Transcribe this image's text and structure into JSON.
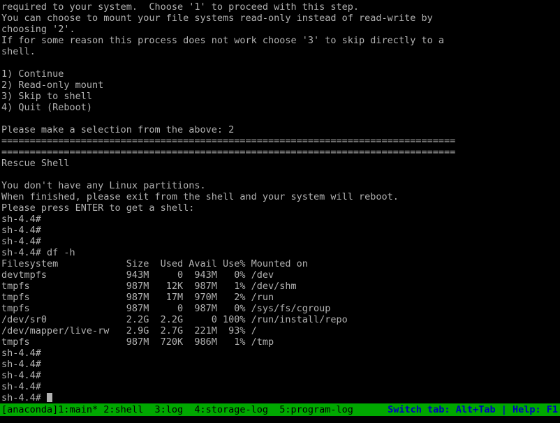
{
  "terminal": {
    "background": "#000000",
    "foreground": "#b2b2b2",
    "cols": 100,
    "rows": 36
  },
  "console": {
    "lines": [
      "required to your system.  Choose '1' to proceed with this step.",
      "You can choose to mount your file systems read-only instead of read-write by",
      "choosing '2'.",
      "If for some reason this process does not work choose '3' to skip directly to a",
      "shell.",
      "",
      "1) Continue",
      "2) Read-only mount",
      "3) Skip to shell",
      "4) Quit (Reboot)",
      "",
      "Please make a selection from the above: 2",
      "================================================================================",
      "================================================================================",
      "Rescue Shell",
      "",
      "You don't have any Linux partitions.",
      "When finished, please exit from the shell and your system will reboot.",
      "Please press ENTER to get a shell:",
      "sh-4.4# ",
      "sh-4.4# ",
      "sh-4.4# ",
      "sh-4.4# df -h",
      "Filesystem            Size  Used Avail Use% Mounted on",
      "devtmpfs              943M     0  943M   0% /dev",
      "tmpfs                 987M   12K  987M   1% /dev/shm",
      "tmpfs                 987M   17M  970M   2% /run",
      "tmpfs                 987M     0  987M   0% /sys/fs/cgroup",
      "/dev/sr0              2.2G  2.2G     0 100% /run/install/repo",
      "/dev/mapper/live-rw   2.9G  2.7G  221M  93% /",
      "tmpfs                 987M  720K  986M   1% /tmp",
      "sh-4.4# ",
      "sh-4.4# ",
      "sh-4.4# ",
      "sh-4.4# ",
      "sh-4.4# "
    ],
    "prompt": "sh-4.4#",
    "command": "df -h",
    "menu_prompt": "Please make a selection from the above:",
    "menu_answer": "2",
    "section_title": "Rescue Shell",
    "separator": "================================================================================",
    "cursor_row_index": 35
  },
  "rescue_menu": {
    "options": [
      {
        "key": "1",
        "label": "Continue"
      },
      {
        "key": "2",
        "label": "Read-only mount"
      },
      {
        "key": "3",
        "label": "Skip to shell"
      },
      {
        "key": "4",
        "label": "Quit (Reboot)"
      }
    ]
  },
  "df_table": {
    "command": "df -h",
    "headers": [
      "Filesystem",
      "Size",
      "Used",
      "Avail",
      "Use%",
      "Mounted on"
    ],
    "rows": [
      {
        "filesystem": "devtmpfs",
        "size": "943M",
        "used": "0",
        "avail": "943M",
        "use_pct": "0%",
        "mounted_on": "/dev"
      },
      {
        "filesystem": "tmpfs",
        "size": "987M",
        "used": "12K",
        "avail": "987M",
        "use_pct": "1%",
        "mounted_on": "/dev/shm"
      },
      {
        "filesystem": "tmpfs",
        "size": "987M",
        "used": "17M",
        "avail": "970M",
        "use_pct": "2%",
        "mounted_on": "/run"
      },
      {
        "filesystem": "tmpfs",
        "size": "987M",
        "used": "0",
        "avail": "987M",
        "use_pct": "0%",
        "mounted_on": "/sys/fs/cgroup"
      },
      {
        "filesystem": "/dev/sr0",
        "size": "2.2G",
        "used": "2.2G",
        "avail": "0",
        "use_pct": "100%",
        "mounted_on": "/run/install/repo"
      },
      {
        "filesystem": "/dev/mapper/live-rw",
        "size": "2.9G",
        "used": "2.7G",
        "avail": "221M",
        "use_pct": "93%",
        "mounted_on": "/"
      },
      {
        "filesystem": "tmpfs",
        "size": "987M",
        "used": "720K",
        "avail": "986M",
        "use_pct": "1%",
        "mounted_on": "/tmp"
      }
    ]
  },
  "statusbar": {
    "background": "#00a800",
    "text_color": "#000000",
    "hint_color": "#0000c0",
    "app_label": "[anaconda]",
    "tabs": [
      {
        "index": "1",
        "name": "main",
        "label": "1:main*",
        "active": true
      },
      {
        "index": "2",
        "name": "shell",
        "label": "2:shell",
        "active": false
      },
      {
        "index": "3",
        "name": "log",
        "label": "3:log",
        "active": false
      },
      {
        "index": "4",
        "name": "storage-log",
        "label": "4:storage-log",
        "active": false
      },
      {
        "index": "5",
        "name": "program-log",
        "label": "5:program-log",
        "active": false
      }
    ],
    "left_text": "[anaconda]1:main* 2:shell  3:log  4:storage-log  5:program-log",
    "right_text": "Switch tab: Alt+Tab | Help: F1"
  }
}
